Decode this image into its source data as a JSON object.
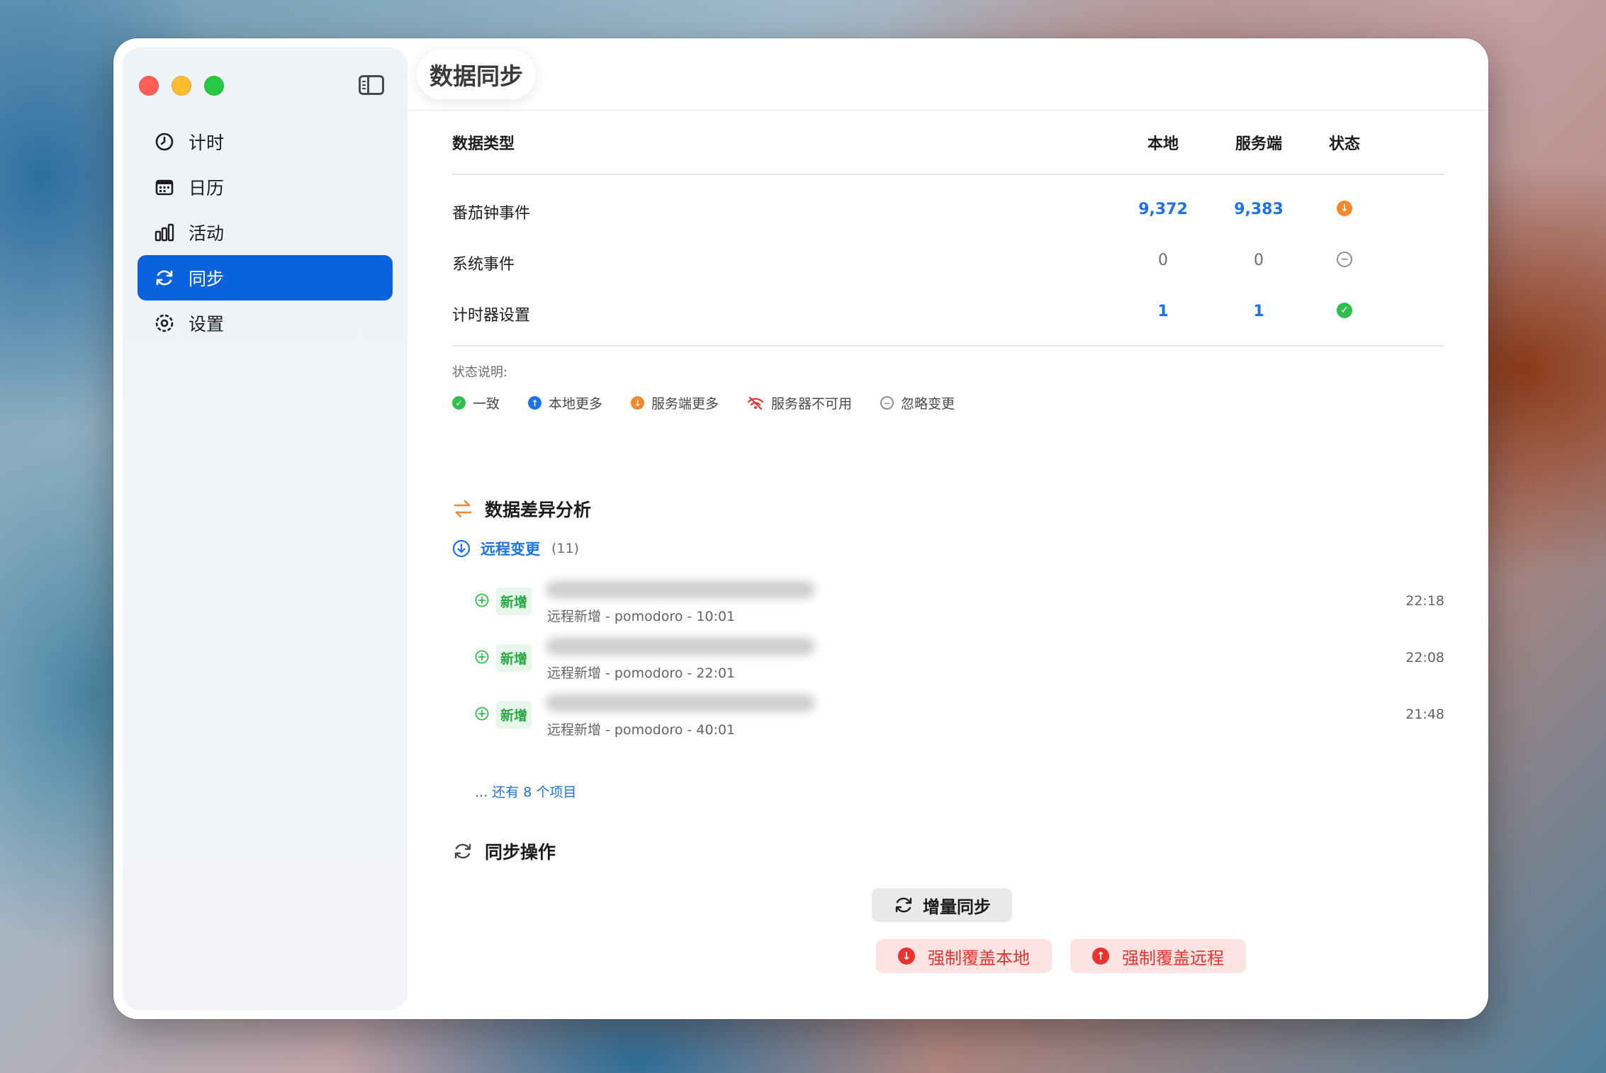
{
  "window": {
    "title": "数据同步"
  },
  "sidebar": {
    "items": [
      {
        "label": "计时",
        "icon": "timer-icon",
        "active": false
      },
      {
        "label": "日历",
        "icon": "calendar-icon",
        "active": false
      },
      {
        "label": "活动",
        "icon": "chart-icon",
        "active": false
      },
      {
        "label": "同步",
        "icon": "sync-icon",
        "active": true
      },
      {
        "label": "设置",
        "icon": "gear-icon",
        "active": false
      }
    ]
  },
  "table": {
    "headers": {
      "type": "数据类型",
      "local": "本地",
      "server": "服务端",
      "status": "状态"
    },
    "rows": [
      {
        "type": "番茄钟事件",
        "local": "9,372",
        "server": "9,383",
        "status": "server-more"
      },
      {
        "type": "系统事件",
        "local": "0",
        "server": "0",
        "status": "ignore"
      },
      {
        "type": "计时器设置",
        "local": "1",
        "server": "1",
        "status": "consistent"
      }
    ]
  },
  "legend": {
    "title": "状态说明:",
    "items": [
      {
        "label": "一致",
        "color": "#2fbf4a"
      },
      {
        "label": "本地更多",
        "color": "#1a73e8"
      },
      {
        "label": "服务端更多",
        "color": "#f5882b"
      },
      {
        "label": "服务器不可用",
        "color": "#e8342f"
      },
      {
        "label": "忽略变更",
        "color": "#8e8e93"
      }
    ]
  },
  "diff": {
    "title": "数据差异分析",
    "remote_label": "远程变更",
    "remote_count": "(11)",
    "items": [
      {
        "badge": "新增",
        "subtitle": "远程新增 - pomodoro - 10:01",
        "time": "22:18"
      },
      {
        "badge": "新增",
        "subtitle": "远程新增 - pomodoro - 22:01",
        "time": "22:08"
      },
      {
        "badge": "新增",
        "subtitle": "远程新增 - pomodoro - 40:01",
        "time": "21:48"
      }
    ],
    "more": "... 还有 8 个项目"
  },
  "ops": {
    "title": "同步操作",
    "incremental": "增量同步",
    "force_local": "强制覆盖本地",
    "force_remote": "强制覆盖远程"
  },
  "colors": {
    "accent": "#0a63dc",
    "danger": "#e8342f",
    "success": "#2fbf4a",
    "warning": "#f5882b"
  }
}
